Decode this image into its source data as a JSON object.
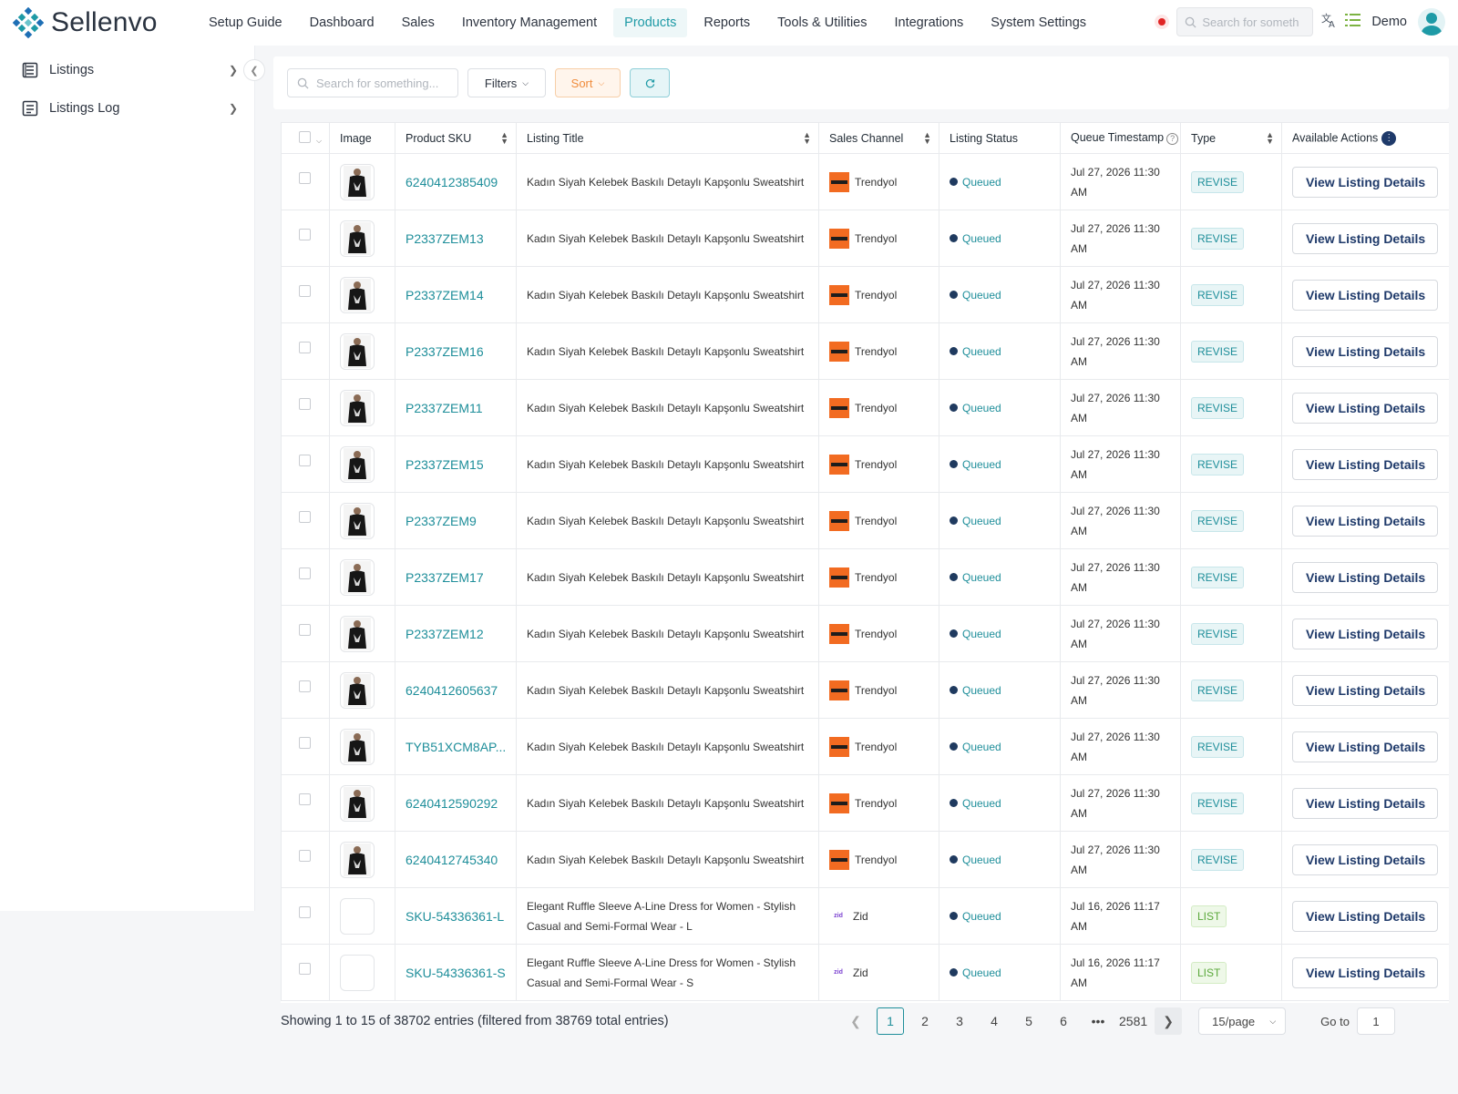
{
  "brand": {
    "name": "Sellenvo",
    "accent": "#1e9aa6"
  },
  "nav": {
    "items": [
      {
        "label": "Setup Guide"
      },
      {
        "label": "Dashboard"
      },
      {
        "label": "Sales"
      },
      {
        "label": "Inventory Management"
      },
      {
        "label": "Products",
        "active": true
      },
      {
        "label": "Reports"
      },
      {
        "label": "Tools & Utilities"
      },
      {
        "label": "Integrations"
      },
      {
        "label": "System Settings"
      }
    ],
    "search_placeholder": "Search for someth",
    "user": "Demo"
  },
  "sidebar": {
    "items": [
      {
        "label": "Listings",
        "icon": "list-icon"
      },
      {
        "label": "Listings Log",
        "icon": "log-icon"
      }
    ]
  },
  "toolbar": {
    "search_placeholder": "Search for something...",
    "filters_label": "Filters",
    "sort_label": "Sort"
  },
  "table": {
    "columns": [
      "Image",
      "Product SKU",
      "Listing Title",
      "Sales Channel",
      "Listing Status",
      "Queue Timestamp",
      "Type",
      "Available Actions"
    ],
    "rows": [
      {
        "sku": "6240412385409",
        "title": "Kadın Siyah Kelebek Baskılı Detaylı Kapşonlu Sweatshirt",
        "channel": "Trendyol",
        "status": "Queued",
        "ts": "Jul 27, 2026 11:30 AM",
        "type": "REVISE",
        "action": "View Listing Details"
      },
      {
        "sku": "P2337ZEM13",
        "title": "Kadın Siyah Kelebek Baskılı Detaylı Kapşonlu Sweatshirt",
        "channel": "Trendyol",
        "status": "Queued",
        "ts": "Jul 27, 2026 11:30 AM",
        "type": "REVISE",
        "action": "View Listing Details"
      },
      {
        "sku": "P2337ZEM14",
        "title": "Kadın Siyah Kelebek Baskılı Detaylı Kapşonlu Sweatshirt",
        "channel": "Trendyol",
        "status": "Queued",
        "ts": "Jul 27, 2026 11:30 AM",
        "type": "REVISE",
        "action": "View Listing Details"
      },
      {
        "sku": "P2337ZEM16",
        "title": "Kadın Siyah Kelebek Baskılı Detaylı Kapşonlu Sweatshirt",
        "channel": "Trendyol",
        "status": "Queued",
        "ts": "Jul 27, 2026 11:30 AM",
        "type": "REVISE",
        "action": "View Listing Details"
      },
      {
        "sku": "P2337ZEM11",
        "title": "Kadın Siyah Kelebek Baskılı Detaylı Kapşonlu Sweatshirt",
        "channel": "Trendyol",
        "status": "Queued",
        "ts": "Jul 27, 2026 11:30 AM",
        "type": "REVISE",
        "action": "View Listing Details"
      },
      {
        "sku": "P2337ZEM15",
        "title": "Kadın Siyah Kelebek Baskılı Detaylı Kapşonlu Sweatshirt",
        "channel": "Trendyol",
        "status": "Queued",
        "ts": "Jul 27, 2026 11:30 AM",
        "type": "REVISE",
        "action": "View Listing Details"
      },
      {
        "sku": "P2337ZEM9",
        "title": "Kadın Siyah Kelebek Baskılı Detaylı Kapşonlu Sweatshirt",
        "channel": "Trendyol",
        "status": "Queued",
        "ts": "Jul 27, 2026 11:30 AM",
        "type": "REVISE",
        "action": "View Listing Details"
      },
      {
        "sku": "P2337ZEM17",
        "title": "Kadın Siyah Kelebek Baskılı Detaylı Kapşonlu Sweatshirt",
        "channel": "Trendyol",
        "status": "Queued",
        "ts": "Jul 27, 2026 11:30 AM",
        "type": "REVISE",
        "action": "View Listing Details"
      },
      {
        "sku": "P2337ZEM12",
        "title": "Kadın Siyah Kelebek Baskılı Detaylı Kapşonlu Sweatshirt",
        "channel": "Trendyol",
        "status": "Queued",
        "ts": "Jul 27, 2026 11:30 AM",
        "type": "REVISE",
        "action": "View Listing Details"
      },
      {
        "sku": "6240412605637",
        "title": "Kadın Siyah Kelebek Baskılı Detaylı Kapşonlu Sweatshirt",
        "channel": "Trendyol",
        "status": "Queued",
        "ts": "Jul 27, 2026 11:30 AM",
        "type": "REVISE",
        "action": "View Listing Details"
      },
      {
        "sku": "TYB51XCM8AP...",
        "title": "Kadın Siyah Kelebek Baskılı Detaylı Kapşonlu Sweatshirt",
        "channel": "Trendyol",
        "status": "Queued",
        "ts": "Jul 27, 2026 11:30 AM",
        "type": "REVISE",
        "action": "View Listing Details"
      },
      {
        "sku": "6240412590292",
        "title": "Kadın Siyah Kelebek Baskılı Detaylı Kapşonlu Sweatshirt",
        "channel": "Trendyol",
        "status": "Queued",
        "ts": "Jul 27, 2026 11:30 AM",
        "type": "REVISE",
        "action": "View Listing Details"
      },
      {
        "sku": "6240412745340",
        "title": "Kadın Siyah Kelebek Baskılı Detaylı Kapşonlu Sweatshirt",
        "channel": "Trendyol",
        "status": "Queued",
        "ts": "Jul 27, 2026 11:30 AM",
        "type": "REVISE",
        "action": "View Listing Details"
      },
      {
        "sku": "SKU-54336361-L",
        "title": "Elegant Ruffle Sleeve A-Line Dress for Women - Stylish Casual and Semi-Formal Wear - L",
        "channel": "Zid",
        "status": "Queued",
        "ts": "Jul 16, 2026 11:17 AM",
        "type": "LIST",
        "action": "View Listing Details"
      },
      {
        "sku": "SKU-54336361-S",
        "title": "Elegant Ruffle Sleeve A-Line Dress for Women - Stylish Casual and Semi-Formal Wear - S",
        "channel": "Zid",
        "status": "Queued",
        "ts": "Jul 16, 2026 11:17 AM",
        "type": "LIST",
        "action": "View Listing Details"
      }
    ]
  },
  "footer": {
    "showing": "Showing 1 to 15 of 38702 entries (filtered from 38769 total entries)",
    "pages": [
      "1",
      "2",
      "3",
      "4",
      "5",
      "6",
      "•••",
      "2581"
    ],
    "per_page": "15/page",
    "goto_label": "Go to",
    "goto_value": "1"
  }
}
